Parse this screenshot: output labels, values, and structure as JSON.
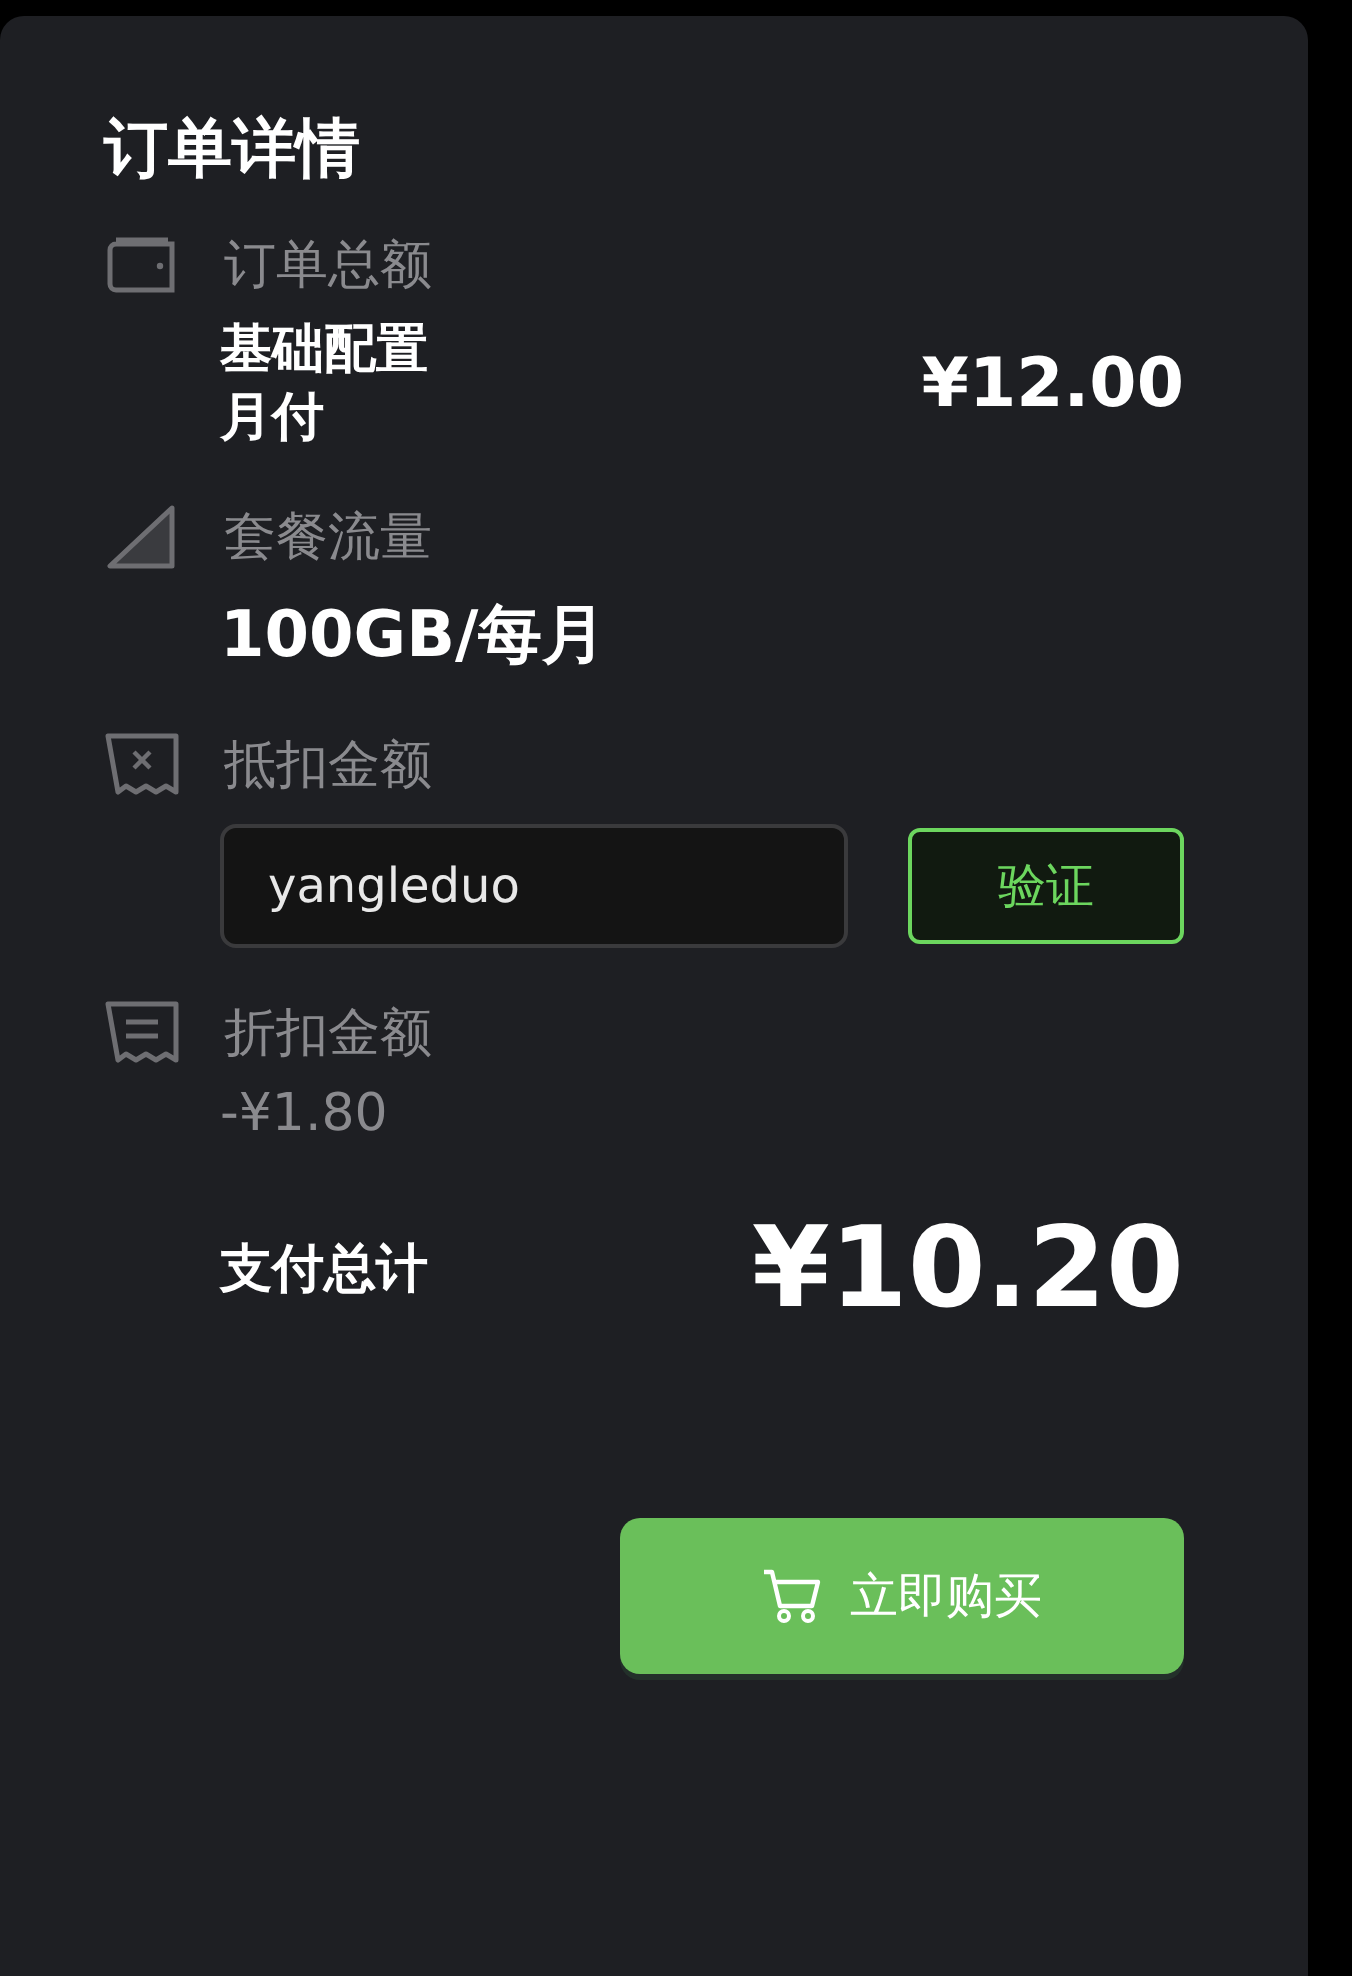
{
  "title": "订单详情",
  "sections": [
    {
      "kind": "amount",
      "label": "订单总额",
      "plan": "基础配置",
      "cycle": "月付",
      "price": "¥12.00"
    },
    {
      "kind": "traffic",
      "label": "套餐流量",
      "value": "100GB/每月"
    },
    {
      "kind": "coupon",
      "label": "抵扣金额",
      "input_value": "yangleduo",
      "button": "验证"
    },
    {
      "kind": "discount",
      "label": "折扣金额",
      "value": "-¥1.80"
    }
  ],
  "total": {
    "label": "支付总计",
    "value": "¥10.20"
  },
  "buy_button": "立即购买"
}
